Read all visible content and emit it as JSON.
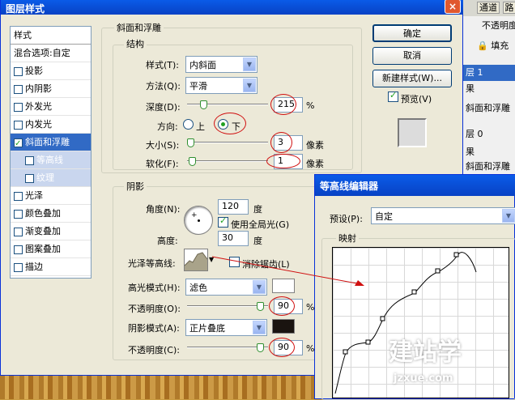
{
  "main_dialog": {
    "title": "图层样式",
    "close": "×"
  },
  "left_list": {
    "header": "样式",
    "items": [
      {
        "label": "混合选项:自定",
        "checkbox": false
      },
      {
        "label": "投影",
        "checkbox": true,
        "checked": false
      },
      {
        "label": "内阴影",
        "checkbox": true,
        "checked": false
      },
      {
        "label": "外发光",
        "checkbox": true,
        "checked": false
      },
      {
        "label": "内发光",
        "checkbox": true,
        "checked": false
      },
      {
        "label": "斜面和浮雕",
        "checkbox": true,
        "checked": true,
        "selected": true
      },
      {
        "label": "等高线",
        "checkbox": true,
        "checked": false,
        "sub": true
      },
      {
        "label": "纹理",
        "checkbox": true,
        "checked": false,
        "sub": true
      },
      {
        "label": "光泽",
        "checkbox": true,
        "checked": false
      },
      {
        "label": "颜色叠加",
        "checkbox": true,
        "checked": false
      },
      {
        "label": "渐变叠加",
        "checkbox": true,
        "checked": false
      },
      {
        "label": "图案叠加",
        "checkbox": true,
        "checked": false
      },
      {
        "label": "描边",
        "checkbox": true,
        "checked": false
      }
    ]
  },
  "bevel": {
    "group_title": "斜面和浮雕",
    "structure_title": "结构",
    "style_label": "样式(T):",
    "style_value": "内斜面",
    "method_label": "方法(Q):",
    "method_value": "平滑",
    "depth_label": "深度(D):",
    "depth_value": "215",
    "depth_unit": "%",
    "direction_label": "方向:",
    "dir_up": "上",
    "dir_down": "下",
    "size_label": "大小(S):",
    "size_value": "3",
    "size_unit": "像素",
    "soften_label": "软化(F):",
    "soften_value": "1",
    "soften_unit": "像素"
  },
  "shading": {
    "title": "阴影",
    "angle_label": "角度(N):",
    "angle_value": "120",
    "angle_unit": "度",
    "global_light": "使用全局光(G)",
    "altitude_label": "高度:",
    "altitude_value": "30",
    "altitude_unit": "度",
    "gloss_contour_label": "光泽等高线:",
    "antialias": "消除锯齿(L)",
    "highlight_mode_label": "高光模式(H):",
    "highlight_mode_value": "滤色",
    "highlight_color": "#ffffff",
    "opacity1_label": "不透明度(O):",
    "opacity1_value": "90",
    "opacity1_unit": "%",
    "shadow_mode_label": "阴影模式(A):",
    "shadow_mode_value": "正片叠底",
    "shadow_color": "#1a1410",
    "opacity2_label": "不透明度(C):",
    "opacity2_value": "90",
    "opacity2_unit": "%"
  },
  "buttons": {
    "ok": "确定",
    "cancel": "取消",
    "new_style": "新建样式(W)...",
    "preview": "预览(V)"
  },
  "layers_panel": {
    "tabs": [
      "通道",
      "路"
    ],
    "opacity_label": "不透明度",
    "fill_label": "填充",
    "rows": [
      "层 1",
      "果",
      "斜面和浮雕",
      "层 0",
      "果",
      "斜面和浮雕"
    ]
  },
  "contour_editor": {
    "title": "等高线编辑器",
    "preset_label": "预设(P):",
    "preset_value": "自定",
    "mapping_label": "映射"
  },
  "watermark": {
    "line1": "建站学",
    "line2": "jzxue.com"
  },
  "colors": {
    "selection": "#316ac5",
    "titlebar": "#0842c4",
    "annotation_red": "#d01010"
  }
}
